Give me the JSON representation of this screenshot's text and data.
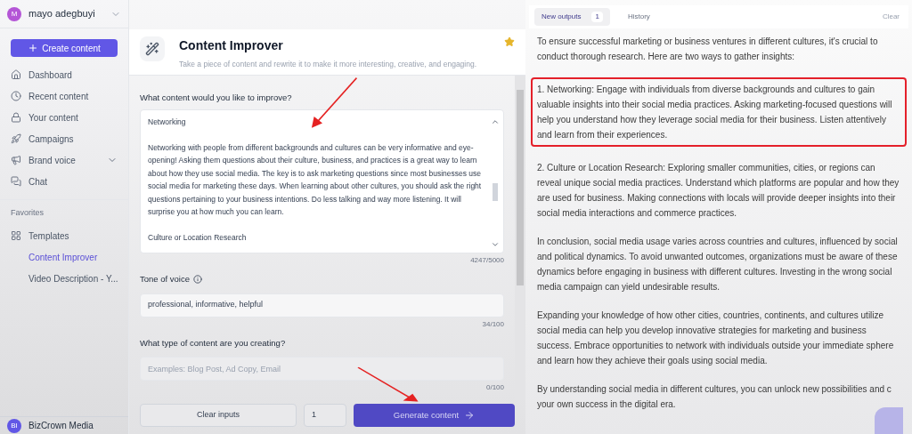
{
  "account": {
    "initial": "M",
    "name": "mayo adegbuyi"
  },
  "create_button": {
    "label": "Create content"
  },
  "nav": [
    {
      "kind": "home",
      "label": "Dashboard",
      "selected": false,
      "expandable": false
    },
    {
      "kind": "clock",
      "label": "Recent content",
      "selected": false,
      "expandable": false
    },
    {
      "kind": "lock",
      "label": "Your content",
      "selected": false,
      "expandable": false
    },
    {
      "kind": "rocket",
      "label": "Campaigns",
      "selected": false,
      "expandable": false
    },
    {
      "kind": "megaphone",
      "label": "Brand voice",
      "selected": false,
      "expandable": true
    },
    {
      "kind": "chat",
      "label": "Chat",
      "selected": false,
      "expandable": false
    }
  ],
  "favorites": {
    "heading": "Favorites",
    "items": [
      {
        "kind": "grid",
        "label": "Templates",
        "selected": false
      },
      {
        "kind": "none",
        "label": "Content Improver",
        "selected": true
      },
      {
        "kind": "none",
        "label": "Video Description - Y...",
        "selected": false
      }
    ]
  },
  "workspace": {
    "initials": "BI",
    "name": "BizCrown Media"
  },
  "tool": {
    "title": "Content Improver",
    "description": "Take a piece of content and rewrite it to make it more interesting, creative, and engaging.",
    "starred": true
  },
  "content_field": {
    "label": "What content would you like to improve?",
    "value": [
      "Networking",
      "Networking with people from different backgrounds and cultures can be very informative and eye-opening! Asking them questions about their culture, business, and practices is a great way to learn about how they use social media. The key is to ask marketing questions since most businesses use social media for marketing these days. When learning about other cultures, you should ask the right questions pertaining to your business intentions. Do less talking and way more listening. It will surprise you at how much you can learn.",
      "Culture or Location Research"
    ],
    "count": "4247/5000"
  },
  "tone_field": {
    "label": "Tone of voice",
    "value": "professional, informative, helpful",
    "count": "34/100"
  },
  "type_field": {
    "label": "What type of content are you creating?",
    "placeholder": "Examples: Blog Post, Ad Copy, Email",
    "count": "0/100"
  },
  "actions": {
    "clear": "Clear inputs",
    "quantity": "1",
    "generate": "Generate content"
  },
  "output_tabs": [
    {
      "label": "New outputs",
      "badge": "1",
      "selected": true
    },
    {
      "label": "History",
      "selected": false
    }
  ],
  "clear_link": "Clear",
  "output": [
    {
      "text": "To ensure successful marketing or business ventures in different cultures, it's crucial to conduct thorough research. Here are two ways to gather insights:",
      "highlighted": false
    },
    {
      "text": "1. Networking: Engage with individuals from diverse backgrounds and cultures to gain valuable insights into their social media practices. Asking marketing-focused questions will help you understand how they leverage social media for their business. Listen attentively and learn from their experiences.",
      "highlighted": true
    },
    {
      "text": "2. Culture or Location Research: Exploring smaller communities, cities, or regions can reveal unique social media practices. Understand which platforms are popular and how they are used for business. Making connections with locals will provide deeper insights into their social media interactions and commerce practices.",
      "highlighted": false
    },
    {
      "text": "In conclusion, social media usage varies across countries and cultures, influenced by social and political dynamics. To avoid unwanted outcomes, organizations must be aware of these dynamics before engaging in business with different cultures. Investing in the wrong social media campaign can yield undesirable results.",
      "highlighted": false
    },
    {
      "text": "Expanding your knowledge of how other cities, countries, continents, and cultures utilize social media can help you develop innovative strategies for marketing and business success. Embrace opportunities to network with individuals outside your immediate sphere and learn how they achieve their goals using social media.",
      "highlighted": false
    },
    {
      "text": "By understanding social media in different cultures, you can unlock new possibilities and c",
      "highlighted": false
    },
    {
      "text": "your own success in the digital era.",
      "highlighted": false
    }
  ]
}
